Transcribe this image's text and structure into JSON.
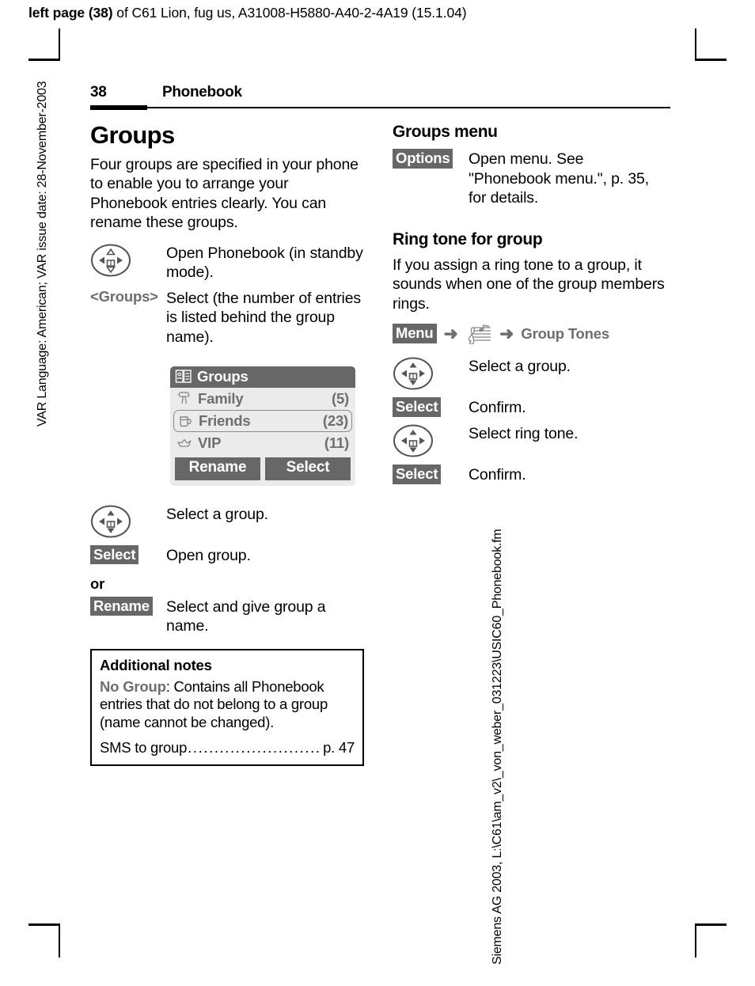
{
  "running_head": {
    "bold_part": "left page (38)",
    "rest": " of C61 Lion, fug us, A31008-H5880-A40-2-4A19 (15.1.04)"
  },
  "side_texts": {
    "left": "VAR Language: American; VAR issue date: 28-November-2003",
    "right": "Siemens AG 2003, L:\\C61\\am_v2\\_von_weber_031223\\USIC60_Phonebook.fm"
  },
  "header": {
    "page_number": "38",
    "chapter": "Phonebook"
  },
  "left_column": {
    "heading": "Groups",
    "intro": "Four groups are specified in your phone to enable you to arrange your Phonebook entries clearly. You can rename these groups.",
    "steps_top": [
      {
        "key_type": "navkey",
        "key_label": "navigation-key",
        "desc": "Open Phonebook (in standby mode)."
      },
      {
        "key_type": "greylabel",
        "key_label": "<Groups>",
        "desc": "Select (the number of entries is listed behind the group name)."
      }
    ],
    "phone_screen": {
      "title": "Groups",
      "title_icon": "phonebook-icon",
      "rows": [
        {
          "icon": "tree-icon",
          "label": "Family",
          "count": "(5)",
          "selected": false
        },
        {
          "icon": "mug-icon",
          "label": "Friends",
          "count": "(23)",
          "selected": true
        },
        {
          "icon": "crown-icon",
          "label": "VIP",
          "count": "(11)",
          "selected": false
        }
      ],
      "softkeys": [
        "Rename",
        "Select"
      ]
    },
    "steps_bottom": [
      {
        "key_type": "navkey",
        "key_label": "navigation-key",
        "desc": "Select a group."
      },
      {
        "key_type": "softkey",
        "key_label": "Select",
        "desc": "Open group."
      }
    ],
    "or_word": "or",
    "steps_or": [
      {
        "key_type": "softkey",
        "key_label": "Rename",
        "desc": "Select and give group a name."
      }
    ],
    "notes": {
      "title": "Additional notes",
      "grey_term": "No Group",
      "paragraph": ": Contains all Phonebook entries that do not belong to a group (name cannot be changed).",
      "toc_label": "SMS to group",
      "toc_page": "p. 47"
    }
  },
  "right_column": {
    "heading_menu": "Groups menu",
    "steps_menu": [
      {
        "key_type": "softkey",
        "key_label": "Options",
        "desc": "Open menu. See \"Phonebook menu.\", p. 35, for details."
      }
    ],
    "heading_ringtone": "Ring tone for group",
    "intro_ringtone": "If you assign a ring tone to a group, it sounds when one of the group members rings.",
    "menu_path": {
      "start_key": "Menu",
      "arrow": "➜",
      "icon_label": "music-staff-icon",
      "end_item": "Group Tones"
    },
    "steps_ringtone": [
      {
        "key_type": "navkey",
        "key_label": "navigation-key",
        "desc": "Select a group."
      },
      {
        "key_type": "softkey",
        "key_label": "Select",
        "desc": "Confirm."
      },
      {
        "key_type": "navkey",
        "key_label": "navigation-key",
        "desc": "Select ring tone."
      },
      {
        "key_type": "softkey",
        "key_label": "Select",
        "desc": "Confirm."
      }
    ]
  },
  "colors": {
    "grey_text": "#6e6e6e",
    "softkey_bg": "#676767",
    "screen_bg": "#ebebeb"
  }
}
